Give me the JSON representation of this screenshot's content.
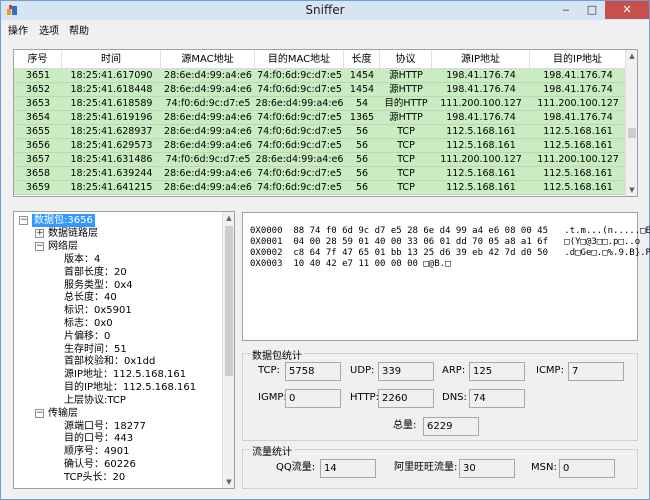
{
  "window": {
    "title": "Sniffer",
    "minimize": "‒",
    "maximize": "□",
    "close": "✕"
  },
  "menu": [
    "操作",
    "选项",
    "帮助"
  ],
  "packet_table": {
    "columns": [
      "序号",
      "时间",
      "源MAC地址",
      "目的MAC地址",
      "长度",
      "协议",
      "源IP地址",
      "目的IP地址"
    ],
    "rows": [
      [
        "3651",
        "18:25:41.617090",
        "28:6e:d4:99:a4:e6",
        "74:f0:6d:9c:d7:e5",
        "1454",
        "源HTTP",
        "198.41.176.74",
        "198.41.176.74"
      ],
      [
        "3652",
        "18:25:41.618448",
        "28:6e:d4:99:a4:e6",
        "74:f0:6d:9c:d7:e5",
        "1454",
        "源HTTP",
        "198.41.176.74",
        "198.41.176.74"
      ],
      [
        "3653",
        "18:25:41.618589",
        "74:f0:6d:9c:d7:e5",
        "28:6e:d4:99:a4:e6",
        "54",
        "目的HTTP",
        "111.200.100.127",
        "111.200.100.127"
      ],
      [
        "3654",
        "18:25:41.619196",
        "28:6e:d4:99:a4:e6",
        "74:f0:6d:9c:d7:e5",
        "1365",
        "源HTTP",
        "198.41.176.74",
        "198.41.176.74"
      ],
      [
        "3655",
        "18:25:41.628937",
        "28:6e:d4:99:a4:e6",
        "74:f0:6d:9c:d7:e5",
        "56",
        "TCP",
        "112.5.168.161",
        "112.5.168.161"
      ],
      [
        "3656",
        "18:25:41.629573",
        "28:6e:d4:99:a4:e6",
        "74:f0:6d:9c:d7:e5",
        "56",
        "TCP",
        "112.5.168.161",
        "112.5.168.161"
      ],
      [
        "3657",
        "18:25:41.631486",
        "74:f0:6d:9c:d7:e5",
        "28:6e:d4:99:a4:e6",
        "56",
        "TCP",
        "111.200.100.127",
        "111.200.100.127"
      ],
      [
        "3658",
        "18:25:41.639244",
        "28:6e:d4:99:a4:e6",
        "74:f0:6d:9c:d7:e5",
        "56",
        "TCP",
        "112.5.168.161",
        "112.5.168.161"
      ],
      [
        "3659",
        "18:25:41.641215",
        "28:6e:d4:99:a4:e6",
        "74:f0:6d:9c:d7:e5",
        "56",
        "TCP",
        "112.5.168.161",
        "112.5.168.161"
      ]
    ]
  },
  "tree": {
    "root": "数据包:3656",
    "datalink": "数据链路层",
    "network": "网络层",
    "network_fields": [
      "版本：4",
      "首部长度：20",
      "服务类型：0x4",
      "总长度：40",
      "标识：0x5901",
      "标志：0x0",
      "片偏移：0",
      "生存时间：51",
      "首部校验和：0x1dd",
      "源IP地址：112.5.168.161",
      "目的IP地址：112.5.168.161",
      "上层协议:TCP"
    ],
    "transport": "传输层",
    "transport_fields": [
      "源端口号：18277",
      "目的口号：443",
      "顺序号：4901",
      "确认号：60226",
      "TCP头长：20"
    ]
  },
  "hex_lines": [
    "0X0000  88 74 f0 6d 9c d7 e5 28 6e d4 99 a4 e6 08 00 45   .t.m...(n.....□E",
    "0X0001  04 00 28 59 01 40 00 33 06 01 dd 70 05 a8 a1 6f   □(Y□@3□□.p□..o",
    "0X0002  c8 64 7f 47 65 01 bb 13 25 d6 39 eb 42 7d d0 50   .d□Ge□.□%.9.B}.P",
    "0X0003  10 40 42 e7 11 00 00 00 □@B.□"
  ],
  "packet_stats": {
    "title": "数据包统计",
    "tcp_label": "TCP:",
    "tcp": "5758",
    "udp_label": "UDP:",
    "udp": "339",
    "arp_label": "ARP:",
    "arp": "125",
    "icmp_label": "ICMP:",
    "icmp": "7",
    "igmp_label": "IGMP:",
    "igmp": "0",
    "http_label": "HTTP:",
    "http": "2260",
    "dns_label": "DNS:",
    "dns": "74",
    "total_label": "总量:",
    "total": "6229"
  },
  "traffic_stats": {
    "title": "流量统计",
    "qq_label": "QQ流量:",
    "qq": "14",
    "aliww_label": "阿里旺旺流量:",
    "aliww": "30",
    "msn_label": "MSN:",
    "msn": "0"
  },
  "colors": {
    "row_bg": "#c9ecc3",
    "selection": "#3399ff",
    "close_button": "#c7504b"
  }
}
